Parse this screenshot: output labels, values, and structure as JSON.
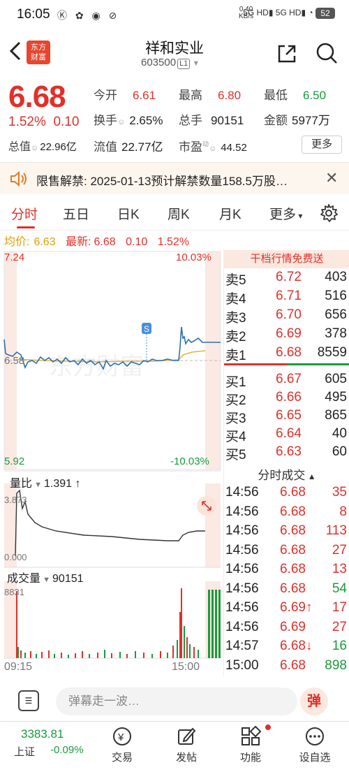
{
  "status_bar": {
    "time": "16:05",
    "icons": [
      "k-icon",
      "bee-icon",
      "wechat-icon",
      "game-icon"
    ],
    "net_speed": "0.40",
    "net_unit": "KB/s",
    "signal1": "5G HD",
    "signal2": "5G HD",
    "battery": "52"
  },
  "header": {
    "logo_line1": "东方",
    "logo_line2": "财富",
    "stock_name": "祥和实业",
    "stock_code": "603500",
    "level": "L1"
  },
  "quote": {
    "price": "6.68",
    "change_pct": "1.52%",
    "change": "0.10",
    "open_label": "今开",
    "open": "6.61",
    "high_label": "最高",
    "high": "6.80",
    "low_label": "最低",
    "low": "6.50",
    "turnover_label": "换手",
    "turnover": "2.65%",
    "volume_label": "总手",
    "volume": "90151",
    "amount_label": "金额",
    "amount": "5977万",
    "mktcap_label": "总值",
    "mktcap": "22.96亿",
    "float_label": "流值",
    "float_cap": "22.77亿",
    "pe_label": "市盈",
    "pe_sup": "动",
    "pe": "44.52",
    "more": "更多"
  },
  "notice": {
    "label": "限售解禁:",
    "text": "2025-01-13预计解禁数量158.5万股…"
  },
  "tabs": [
    "分时",
    "五日",
    "日K",
    "周K",
    "月K",
    "更多"
  ],
  "avg_line": {
    "avg_label": "均价:",
    "avg": "6.63",
    "latest_label": "最新:",
    "latest": "6.68",
    "chg": "0.10",
    "pct": "1.52%"
  },
  "chart_labels": {
    "top_price": "7.24",
    "top_pct": "10.03%",
    "mid_price": "6.58",
    "bottom_price": "5.92",
    "bottom_pct": "-10.03%",
    "watermark": "东方财富",
    "ratio_label": "量比",
    "ratio_value": "1.391",
    "ratio_top": "3.873",
    "ratio_bottom": "0.000",
    "volume_label": "成交量",
    "volume_value": "90151",
    "volume_top": "8831",
    "time_start": "09:15",
    "time_end": "15:00",
    "marker": "S"
  },
  "orderbook": {
    "banner": "干档行情免费送",
    "asks": [
      {
        "label": "卖5",
        "price": "6.72",
        "vol": "403"
      },
      {
        "label": "卖4",
        "price": "6.71",
        "vol": "516"
      },
      {
        "label": "卖3",
        "price": "6.70",
        "vol": "656"
      },
      {
        "label": "卖2",
        "price": "6.69",
        "vol": "378"
      },
      {
        "label": "卖1",
        "price": "6.68",
        "vol": "8559"
      }
    ],
    "bids": [
      {
        "label": "买1",
        "price": "6.67",
        "vol": "605"
      },
      {
        "label": "买2",
        "price": "6.66",
        "vol": "495"
      },
      {
        "label": "买3",
        "price": "6.65",
        "vol": "865"
      },
      {
        "label": "买4",
        "price": "6.64",
        "vol": "40"
      },
      {
        "label": "买5",
        "price": "6.63",
        "vol": "60"
      }
    ]
  },
  "ticks": {
    "title": "分时成交",
    "rows": [
      {
        "time": "14:56",
        "price": "6.68",
        "vol": "35",
        "dir": "r"
      },
      {
        "time": "14:56",
        "price": "6.68",
        "vol": "8",
        "dir": "r"
      },
      {
        "time": "14:56",
        "price": "6.68",
        "vol": "113",
        "dir": "r"
      },
      {
        "time": "14:56",
        "price": "6.68",
        "vol": "27",
        "dir": "r"
      },
      {
        "time": "14:56",
        "price": "6.68",
        "vol": "13",
        "dir": "r"
      },
      {
        "time": "14:56",
        "price": "6.68",
        "vol": "54",
        "dir": "g"
      },
      {
        "time": "14:56",
        "price": "6.69↑",
        "vol": "17",
        "dir": "r"
      },
      {
        "time": "14:56",
        "price": "6.69",
        "vol": "27",
        "dir": "r"
      },
      {
        "time": "14:57",
        "price": "6.68↓",
        "vol": "16",
        "dir": "g"
      },
      {
        "time": "15:00",
        "price": "6.68",
        "vol": "898",
        "dir": "g"
      }
    ]
  },
  "comment": {
    "placeholder": "弹幕走一波…",
    "button": "弹"
  },
  "bottom_nav": {
    "index_value": "3383.81",
    "index_name": "上证",
    "index_change": "-0.09%",
    "items": [
      "交易",
      "发帖",
      "功能",
      "设自选"
    ]
  },
  "colors": {
    "up": "#e0302a",
    "down": "#1a9a3c",
    "price_line": "#2d6fb3",
    "avg_line": "#e8b23a"
  }
}
